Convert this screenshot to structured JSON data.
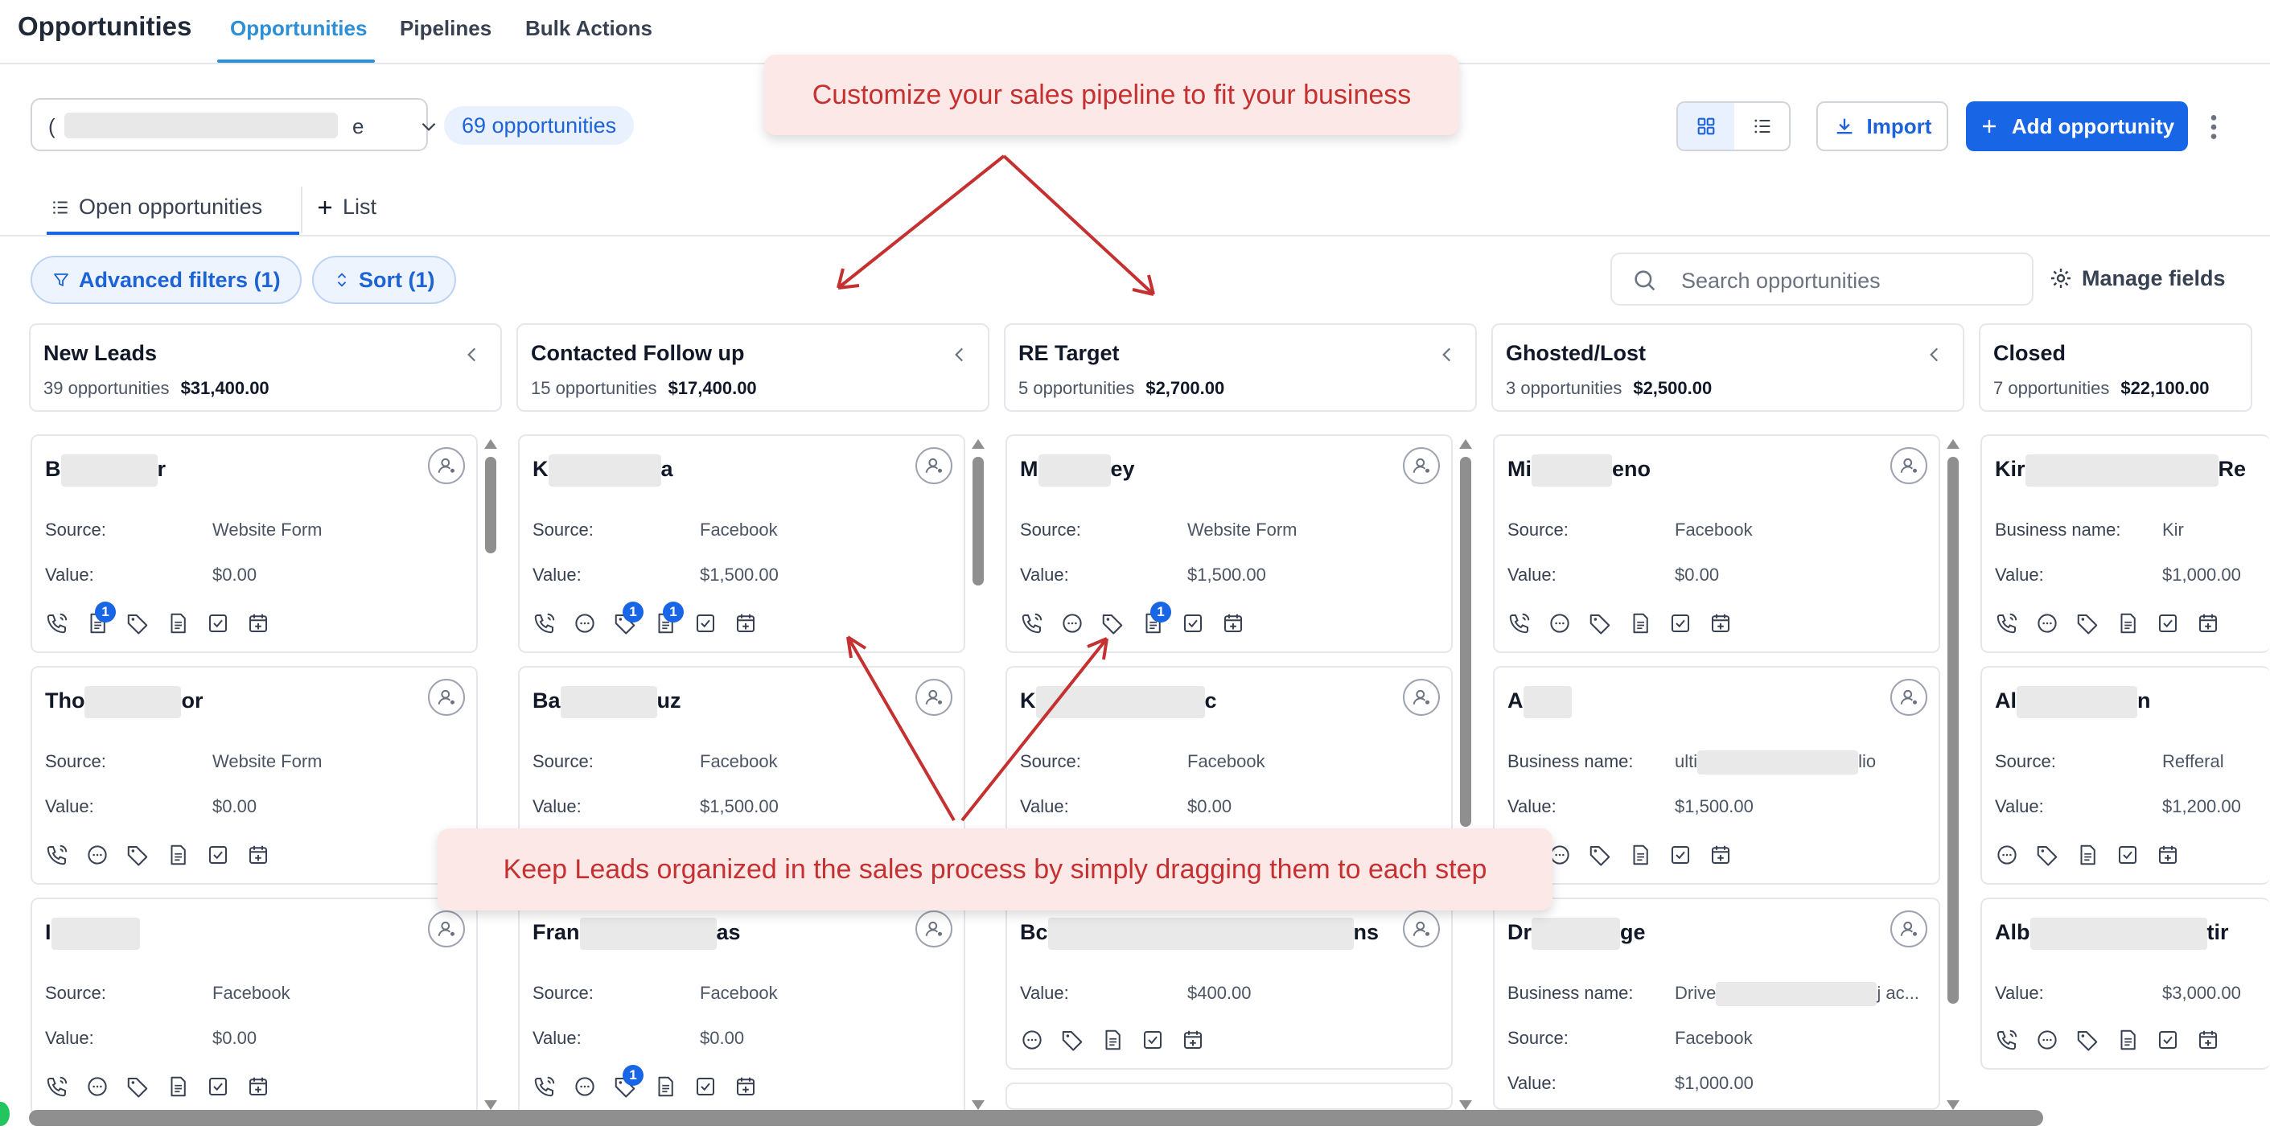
{
  "app": {
    "title": "Opportunities",
    "tabs": [
      "Opportunities",
      "Pipelines",
      "Bulk Actions"
    ]
  },
  "toolbar": {
    "pipeline_prefix": "(",
    "pipeline_suffix": "e",
    "count": "69 opportunities",
    "import_label": "Import",
    "add_label": "Add opportunity"
  },
  "view_tabs": {
    "open": "Open opportunities",
    "list": "List"
  },
  "filters": {
    "advanced": "Advanced filters (1)",
    "sort": "Sort (1)",
    "search_placeholder": "Search opportunities",
    "manage": "Manage fields"
  },
  "columns": [
    {
      "name": "New Leads",
      "count": "39 opportunities",
      "total": "$31,400.00"
    },
    {
      "name": "Contacted Follow up",
      "count": "15 opportunities",
      "total": "$17,400.00"
    },
    {
      "name": "RE Target",
      "count": "5 opportunities",
      "total": "$2,700.00"
    },
    {
      "name": "Ghosted/Lost",
      "count": "3 opportunities",
      "total": "$2,500.00"
    },
    {
      "name": "Closed",
      "count": "7 opportunities",
      "total": "$22,100.00"
    }
  ],
  "labels": {
    "source": "Source:",
    "value": "Value:",
    "business": "Business name:"
  },
  "cards": {
    "c0_0": {
      "a": "B",
      "b": "r",
      "v1": "Website Form",
      "v2": "$0.00",
      "badge": "1"
    },
    "c0_1": {
      "a": "Tho",
      "b": "or",
      "v1": "Website Form",
      "v2": "$0.00"
    },
    "c0_2": {
      "a": "I",
      "b": "",
      "v1": "Facebook",
      "v2": "$0.00"
    },
    "c1_0": {
      "a": "K",
      "b": "a",
      "v1": "Facebook",
      "v2": "$1,500.00",
      "badge": "1",
      "badge2": "1"
    },
    "c1_1": {
      "a": "Ba",
      "b": "uz",
      "v1": "Facebook",
      "v2": "$1,500.00"
    },
    "c1_2": {
      "a": "Fran",
      "b": "as",
      "v1": "Facebook",
      "v2": "$0.00",
      "badge": "1"
    },
    "c2_0": {
      "a": "M",
      "b": "ey",
      "v1": "Website Form",
      "v2": "$1,500.00",
      "badge": "1"
    },
    "c2_1": {
      "a": "K",
      "b": "c",
      "v1": "Facebook",
      "v2": "$0.00"
    },
    "c2_2": {
      "a": "Bc",
      "b": "ns",
      "v2": "$400.00"
    },
    "c3_0": {
      "a": "Mi",
      "b": "eno",
      "v1": "Facebook",
      "v2": "$0.00"
    },
    "c3_1": {
      "a": "A",
      "b": "",
      "v1a": "ulti",
      "v1b": "lio",
      "v2": "$1,500.00"
    },
    "c3_2": {
      "a": "Dr",
      "b": "ge",
      "v1a": "Drive",
      "v1b": "j ac...",
      "v2": "Facebook",
      "v3": "$1,000.00"
    },
    "c4_0": {
      "a": "Kir",
      "b": "Re",
      "v1": "Kir",
      "v2": "$1,000.00"
    },
    "c4_1": {
      "a": "Al",
      "b": "n",
      "v1": "Refferal",
      "v2": "$1,200.00"
    },
    "c4_2": {
      "a": "Alb",
      "b": "tir",
      "v2": "$3,000.00"
    }
  },
  "annotations": {
    "top": "Customize your sales pipeline to fit your business",
    "bottom": "Keep Leads organized in the sales process by simply dragging them to each step"
  },
  "colors": {
    "accent": "#1866e6",
    "tab_active": "#2d8fd5",
    "callout_bg": "#fde8e8",
    "callout_text": "#c53030"
  }
}
